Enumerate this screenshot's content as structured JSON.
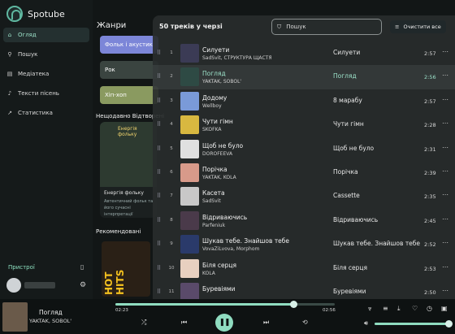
{
  "app": {
    "name": "Spotube"
  },
  "sidebar": {
    "items": [
      {
        "label": "Огляд",
        "icon": "home-icon",
        "active": true
      },
      {
        "label": "Пошук",
        "icon": "search-icon",
        "active": false
      },
      {
        "label": "Медіатека",
        "icon": "library-icon",
        "active": false
      },
      {
        "label": "Тексти пісень",
        "icon": "lyrics-icon",
        "active": false
      },
      {
        "label": "Статистика",
        "icon": "stats-icon",
        "active": false
      }
    ],
    "devices_label": "Пристрої"
  },
  "main": {
    "genres_title": "Жанри",
    "genres": [
      "Фольк і акустик",
      "Рок",
      "Хіп-хоп"
    ],
    "recent_title": "Нещодавно Відтворені",
    "card": {
      "art_title": "Енергія фольку",
      "title": "Енергія фольку",
      "desc": "Автентичний фольк та його сучасні інтерпретації"
    },
    "recommended_title": "Рекомендовані",
    "rec_art_text": "HOT HITS"
  },
  "queue": {
    "title": "50 треків у черзі",
    "search_placeholder": "Пошук",
    "clear_label": "Очистити все",
    "tracks": [
      {
        "num": "1",
        "title": "Силуети",
        "artist": "SadSvit, СТРУКТУРА ЩАСТЯ",
        "album": "Силуети",
        "duration": "2:57",
        "current": false,
        "color": "#3b3b55"
      },
      {
        "num": "2",
        "title": "Погляд",
        "artist": "YAKTAK, SOBOL'",
        "album": "Погляд",
        "duration": "2:56",
        "current": true,
        "color": "#2e4a44"
      },
      {
        "num": "3",
        "title": "Додому",
        "artist": "Wellboy",
        "album": "8 марабу",
        "duration": "2:57",
        "current": false,
        "color": "#7a9ad8"
      },
      {
        "num": "4",
        "title": "Чути гімн",
        "artist": "SKOFKA",
        "album": "Чути гімн",
        "duration": "2:28",
        "current": false,
        "color": "#d8b840"
      },
      {
        "num": "5",
        "title": "Щоб не було",
        "artist": "DOROFEEVA",
        "album": "Щоб не було",
        "duration": "2:31",
        "current": false,
        "color": "#e0e0e0"
      },
      {
        "num": "6",
        "title": "Порічка",
        "artist": "YAKTAK, KOLA",
        "album": "Порічка",
        "duration": "2:39",
        "current": false,
        "color": "#d89a8a"
      },
      {
        "num": "7",
        "title": "Касета",
        "artist": "SadSvit",
        "album": "Cassette",
        "duration": "2:35",
        "current": false,
        "color": "#c8c8c8"
      },
      {
        "num": "8",
        "title": "Відриваючись",
        "artist": "Parfeniuk",
        "album": "Відриваючись",
        "duration": "2:45",
        "current": false,
        "color": "#4a3a4a"
      },
      {
        "num": "9",
        "title": "Шукав тебе. Знайшов тебе",
        "artist": "VovaZiLvova, Morphom",
        "album": "Шукав тебе. Знайшов тебе",
        "duration": "2:52",
        "current": false,
        "color": "#2a3a6a"
      },
      {
        "num": "10",
        "title": "Біля серця",
        "artist": "KOLA",
        "album": "Біля серця",
        "duration": "2:53",
        "current": false,
        "color": "#e8d0c0"
      },
      {
        "num": "11",
        "title": "Буревіями",
        "artist": "",
        "album": "Буревіями",
        "duration": "2:50",
        "current": false,
        "color": "#5a4a6a"
      }
    ]
  },
  "player": {
    "title": "Погляд",
    "artist": "YAKTAK, SOBOL'",
    "time_elapsed": "02:23",
    "time_total": "02:56",
    "progress": 0.81,
    "volume": 0.97
  },
  "colors": {
    "accent": "#8fdcc0",
    "background": "#101414"
  }
}
